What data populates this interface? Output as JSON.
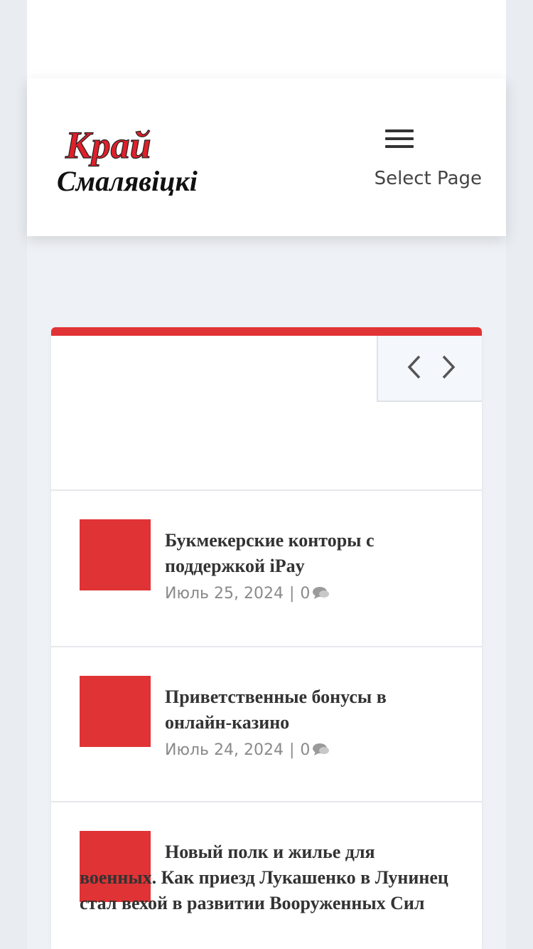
{
  "site": {
    "logo_line1": "Край",
    "logo_line2": "Смалявіцкі",
    "menu_label": "Select Page",
    "accent_color": "#e03335"
  },
  "slider": {
    "prev_icon": "chevron-left-icon",
    "next_icon": "chevron-right-icon"
  },
  "posts": [
    {
      "title": "Букмекерские конторы с поддержкой iPay",
      "date": "Июль 25, 2024",
      "separator": "|",
      "comments": "0"
    },
    {
      "title": "Приветственные бонусы в онлайн-казино",
      "date": "Июль 24, 2024",
      "separator": "|",
      "comments": "0"
    },
    {
      "title": "Новый полк и жилье для военных. Как приезд Лукашенко в Лунинец стал вехой в развитии Вооруженных Сил"
    }
  ]
}
